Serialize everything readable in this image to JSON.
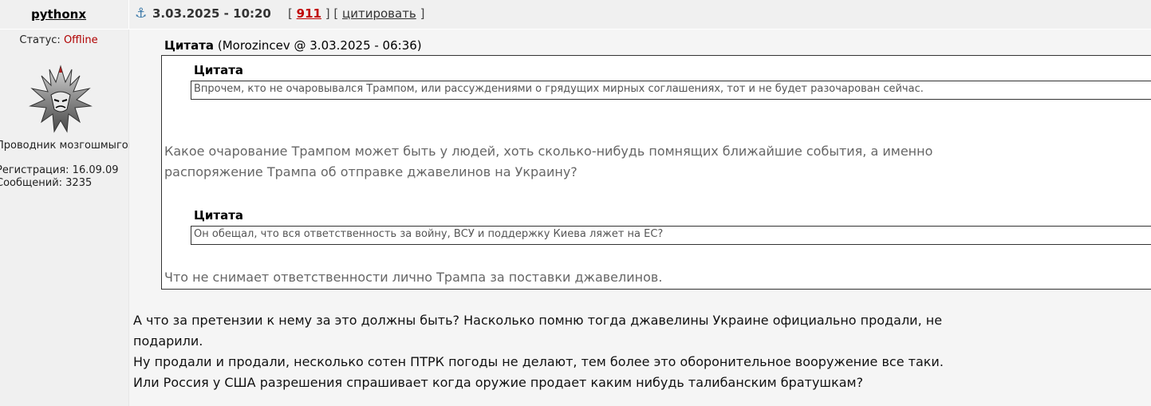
{
  "post": {
    "author": "pythonx",
    "date": "3.03.2025 - 10:20",
    "post_id": "911",
    "quote_action": "цитировать",
    "bracket_open": "[",
    "bracket_close": "]"
  },
  "user": {
    "status_label": "Статус:",
    "status_value": "Offline",
    "title": "Проводник мозгошмыгов",
    "registration": "Регистрация: 16.09.09",
    "messages": "Сообщений: 3235"
  },
  "quote": {
    "label": "Цитата",
    "source": "(Morozincev @ 3.03.2025 - 06:36)",
    "nested_1": {
      "label": "Цитата",
      "text": "Впрочем, кто не очаровывался Трампом, или рассуждениями о грядущих мирных соглашениях, тот и не будет разочарован сейчас."
    },
    "text_1": [
      "Какое очарование Трампом может быть у людей, хоть сколько-нибудь помнящих ближайшие события, а именно",
      "распоряжение Трампа об отправке джавелинов на Украину?"
    ],
    "nested_2": {
      "label": "Цитата",
      "text": "Он обещал, что вся ответственность за войну, ВСУ и поддержку Киева ляжет на ЕС?"
    },
    "text_2": "Что не снимает ответственности лично Трампа за поставки джавелинов."
  },
  "reply": [
    "А что за претензии к нему за это должны быть? Насколько помню тогда джавелины Украине официально продали, не",
    "подарили.",
    "Ну продали и продали, несколько сотен ПТРК погоды не делают, тем более это оборонительное вооружение все таки.",
    "Или Россия у США разрешения спрашивает когда оружие продает каким нибудь талибанским братушкам?"
  ]
}
